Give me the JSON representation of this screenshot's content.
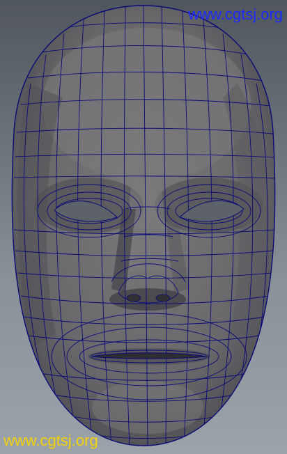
{
  "viewport": {
    "object": "face-mask-polygon-mesh",
    "colors": {
      "background_top": "#50565d",
      "background_bottom": "#9ba3aa",
      "mesh_fill": "#6e6e70",
      "mesh_shadow": "#3a3a3d",
      "wireframe": "#0a0a78"
    }
  },
  "watermarks": {
    "top": "www.cgtsj.org",
    "bottom": "www.cgtsj.org",
    "top_color": "#1c2aff",
    "bottom_color": "#f3d20a"
  }
}
